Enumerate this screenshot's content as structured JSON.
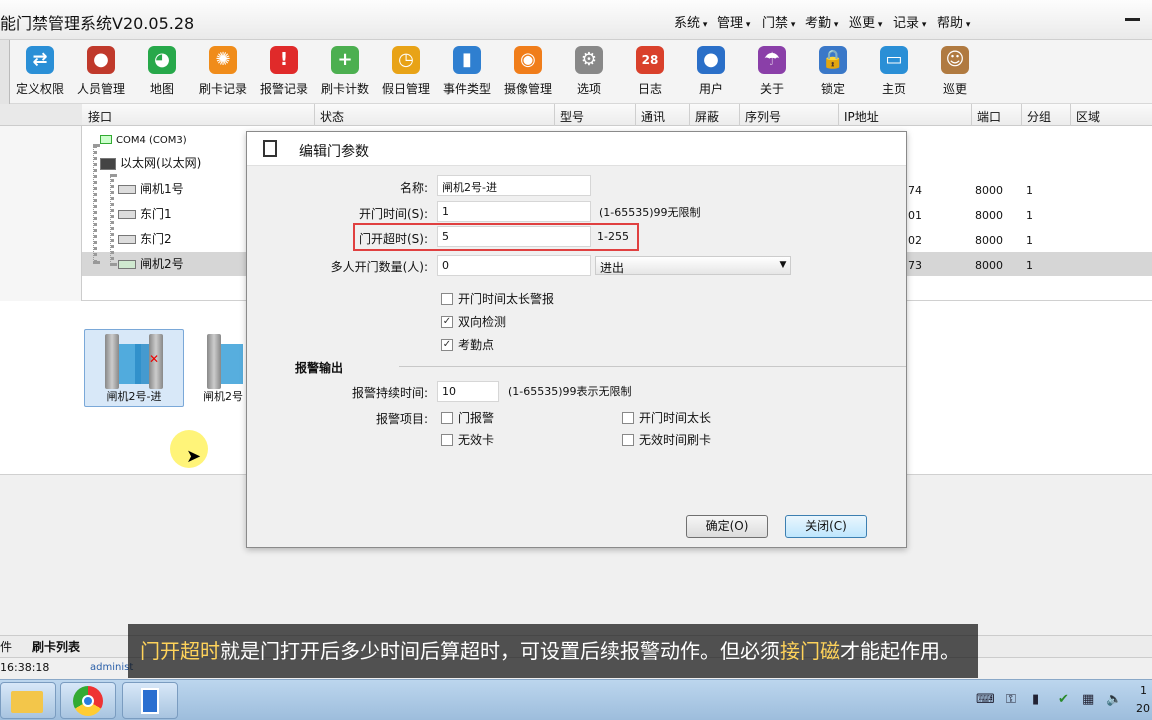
{
  "app": {
    "title": "能门禁管理系统V20.05.28"
  },
  "menu": [
    "系统",
    "管理",
    "门禁",
    "考勤",
    "巡更",
    "记录",
    "帮助"
  ],
  "toolbar": {
    "items": [
      {
        "label": "定义权限",
        "icon": "permission-icon",
        "color": "#2a8fd6"
      },
      {
        "label": "人员管理",
        "icon": "people-icon",
        "color": "#c0392b"
      },
      {
        "label": "地图",
        "icon": "map-icon",
        "color": "#27a84a"
      },
      {
        "label": "刷卡记录",
        "icon": "card-record-icon",
        "color": "#f08c1a"
      },
      {
        "label": "报警记录",
        "icon": "alarm-icon",
        "color": "#e02a2a"
      },
      {
        "label": "刷卡计数",
        "icon": "count-icon",
        "color": "#4caf50"
      },
      {
        "label": "假日管理",
        "icon": "holiday-icon",
        "color": "#e8a317"
      },
      {
        "label": "事件类型",
        "icon": "chart-icon",
        "color": "#2f7fd0"
      },
      {
        "label": "摄像管理",
        "icon": "camera-icon",
        "color": "#f07d1a"
      },
      {
        "label": "选项",
        "icon": "gear-icon",
        "color": "#888888"
      },
      {
        "label": "日志",
        "icon": "calendar-icon",
        "color": "#d9402b"
      },
      {
        "label": "用户",
        "icon": "user-icon",
        "color": "#2a6fc8"
      },
      {
        "label": "关于",
        "icon": "umbrella-icon",
        "color": "#8a3fa8"
      },
      {
        "label": "锁定",
        "icon": "lock-icon",
        "color": "#3a78c8"
      },
      {
        "label": "主页",
        "icon": "home-icon",
        "color": "#2a8fd6"
      },
      {
        "label": "巡更",
        "icon": "patrol-icon",
        "color": "#b07a40"
      }
    ]
  },
  "grid": {
    "columns": [
      "接口",
      "状态",
      "型号",
      "通讯",
      "屏蔽",
      "序列号",
      "IP地址",
      "端口",
      "分组",
      "区域"
    ],
    "tree": {
      "com_node": "COM4 (COM3)",
      "eth_node": "以太网(以太网)",
      "doors": [
        "闸机1号",
        "东门1",
        "东门2",
        "闸机2号"
      ]
    },
    "rows": [
      {
        "ip": "74",
        "port": "8000",
        "group": "1"
      },
      {
        "ip": "01",
        "port": "8000",
        "group": "1"
      },
      {
        "ip": "02",
        "port": "8000",
        "group": "1"
      },
      {
        "ip": "73",
        "port": "8000",
        "group": "1"
      }
    ]
  },
  "preview": {
    "cards": [
      "闸机2号-进",
      "闸机2号"
    ]
  },
  "tabs": [
    "件",
    "刷卡列表"
  ],
  "status": {
    "time": "16:38:18",
    "user": "administ"
  },
  "dialog": {
    "title": "编辑门参数",
    "name_label": "名称:",
    "name_value": "闸机2号-进",
    "open_time_label": "开门时间(S):",
    "open_time_value": "1",
    "open_time_hint": "(1-65535)99无限制",
    "timeout_label": "门开超时(S):",
    "timeout_value": "5",
    "timeout_hint": "1-255",
    "multi_label": "多人开门数量(人):",
    "multi_value": "0",
    "direction_value": "进出",
    "checks": [
      {
        "label": "开门时间太长警报",
        "checked": false
      },
      {
        "label": "双向检测",
        "checked": true
      },
      {
        "label": "考勤点",
        "checked": true
      }
    ],
    "alarm_section": "报警输出",
    "alarm_duration_label": "报警持续时间:",
    "alarm_duration_value": "10",
    "alarm_duration_hint": "(1-65535)99表示无限制",
    "alarm_items_label": "报警项目:",
    "alarm_items": [
      {
        "label": "门报警",
        "checked": false
      },
      {
        "label": "开门时间太长",
        "checked": false
      },
      {
        "label": "无效卡",
        "checked": false
      },
      {
        "label": "无效时间刷卡",
        "checked": false
      }
    ],
    "ok_label": "确定(O)",
    "close_label": "关闭(C)"
  },
  "subtitle": {
    "hl1": "门开超时",
    "mid": "就是门打开后多少时间后算超时，可设置后续报警动作。但必须",
    "hl2": "接门磁",
    "end": "才能起作用。"
  },
  "taskbar": {
    "clock_line1": "1",
    "clock_line2": "20"
  }
}
